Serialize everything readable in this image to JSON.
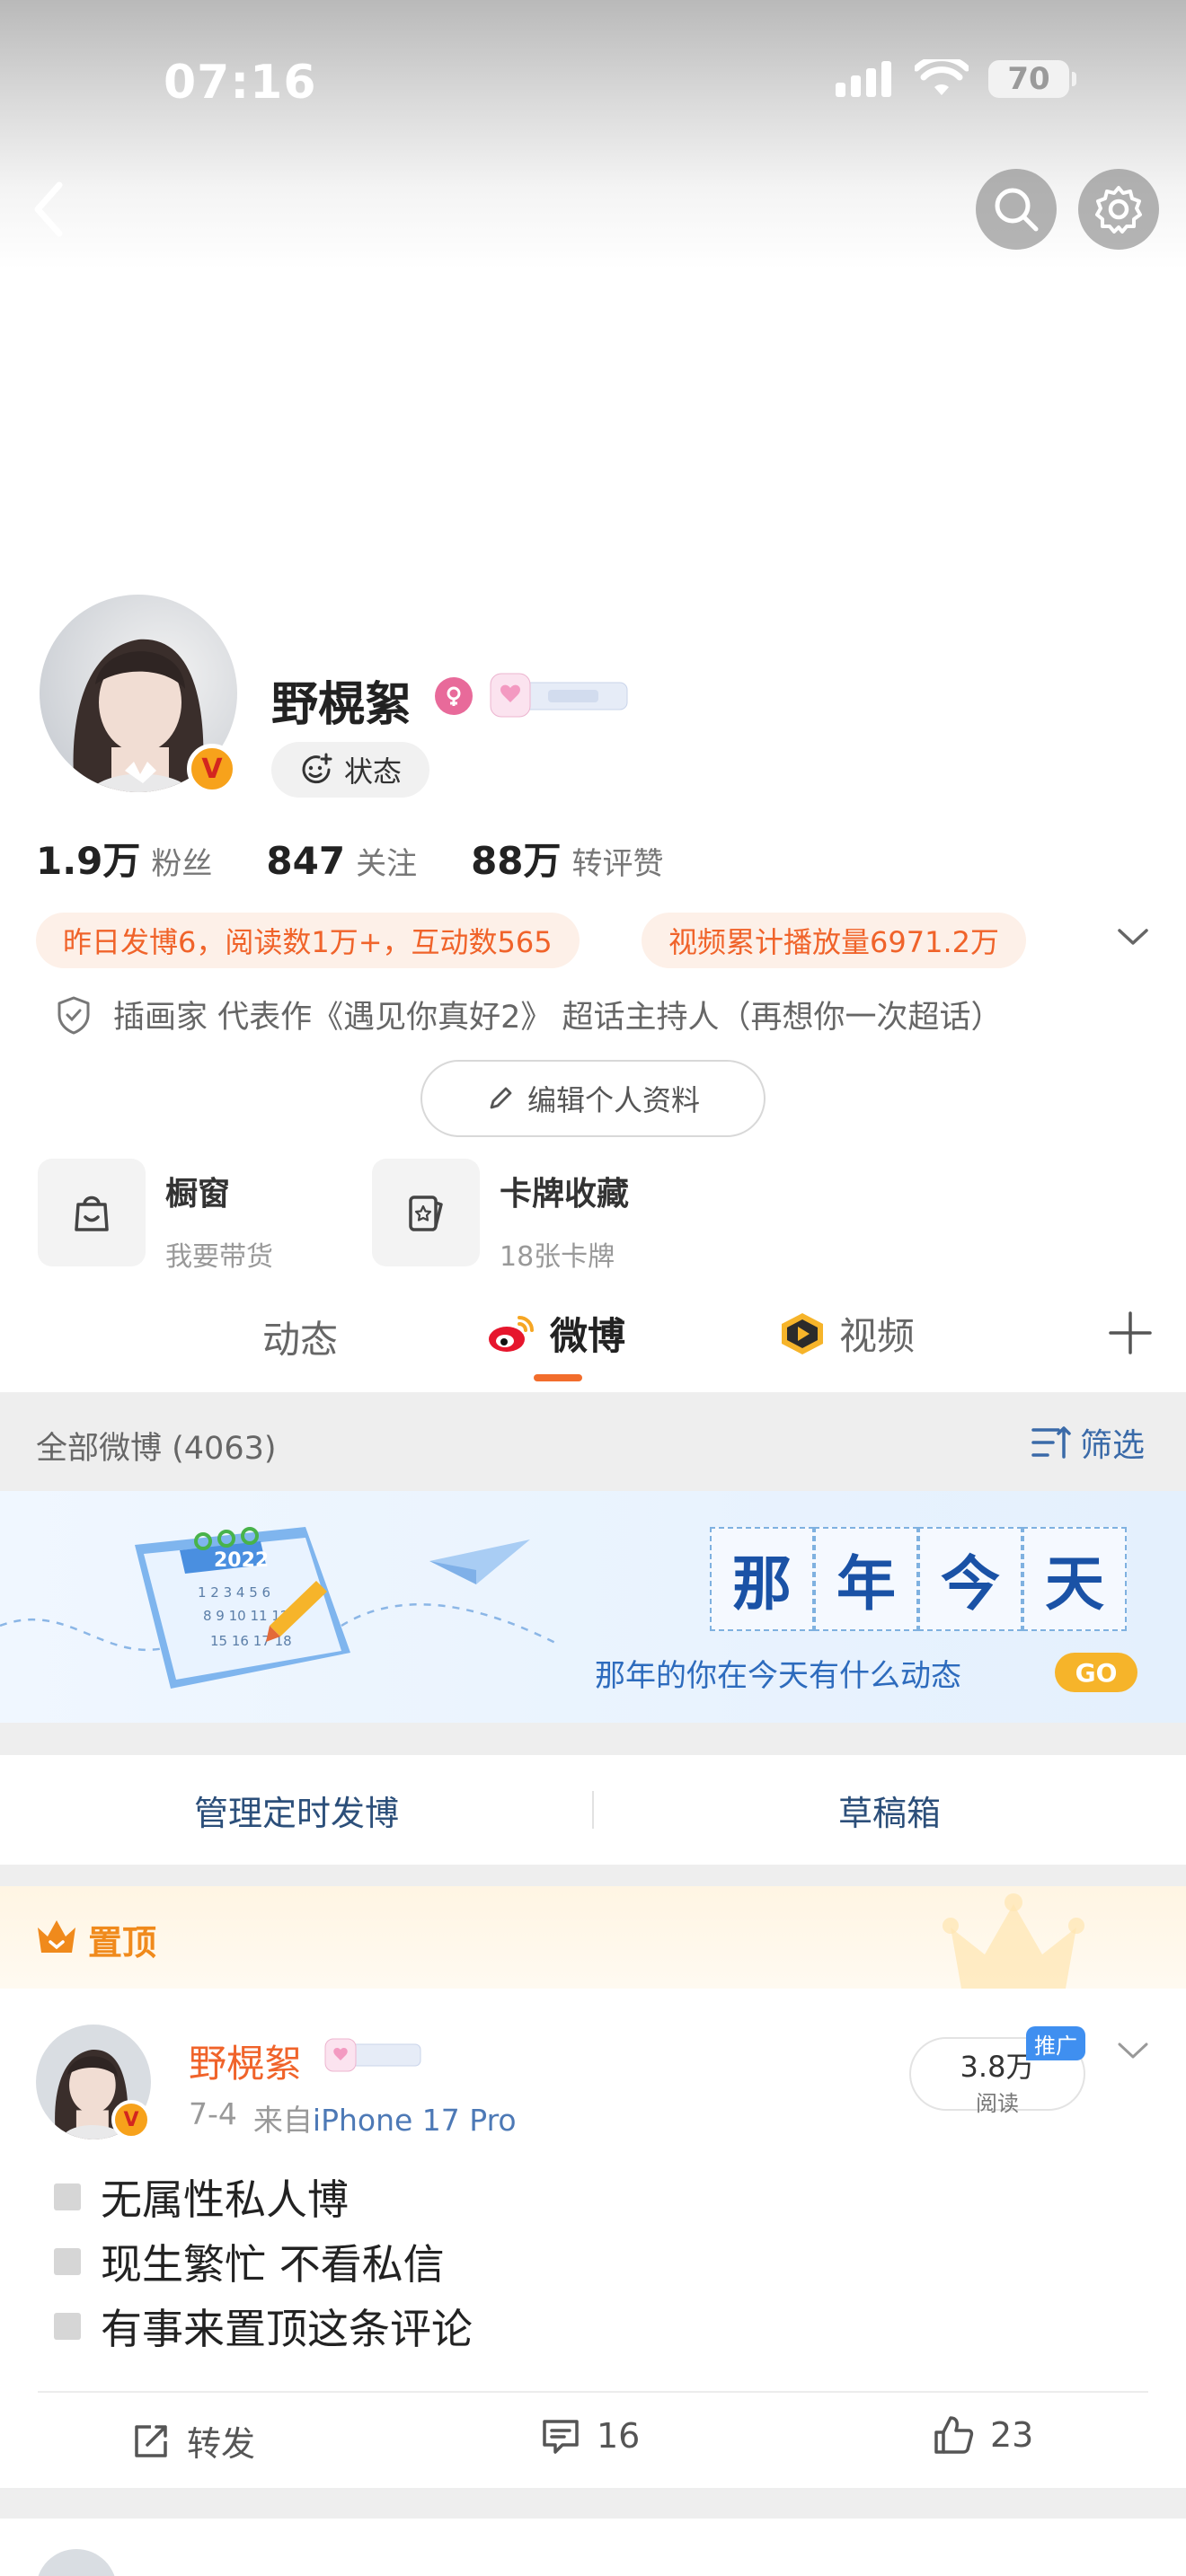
{
  "status_bar": {
    "time": "07:16",
    "battery": "70"
  },
  "profile": {
    "name": "野榥絮",
    "status_button": "状态",
    "stats": [
      {
        "value": "1.9万",
        "label": "粉丝"
      },
      {
        "value": "847",
        "label": "关注"
      },
      {
        "value": "88万",
        "label": "转评赞"
      }
    ],
    "tags": [
      "昨日发博6，阅读数1万+，互动数565",
      "视频累计播放量6971.2万"
    ],
    "bio": "插画家 代表作《遇见你真好2》 超话主持人（再想你一次超话）",
    "edit_button": "编辑个人资料"
  },
  "tools": [
    {
      "title": "橱窗",
      "subtitle": "我要带货",
      "icon": "bag-icon"
    },
    {
      "title": "卡牌收藏",
      "subtitle": "18张卡牌",
      "icon": "card-icon"
    }
  ],
  "tabs": [
    {
      "label": "动态"
    },
    {
      "label": "微博"
    },
    {
      "label": "视频"
    }
  ],
  "feed": {
    "count_label": "全部微博 (4063)",
    "filter_label": "筛选",
    "banner": {
      "chars": [
        "那",
        "年",
        "今",
        "天"
      ],
      "subtitle": "那年的你在今天有什么动态",
      "go_label": "GO",
      "calendar_year": "2022"
    },
    "schedule_label": "管理定时发博",
    "drafts_label": "草稿箱",
    "pinned_label": "置顶"
  },
  "post": {
    "author": "野榥絮",
    "date": "7-4",
    "source_prefix": "来自",
    "source": "iPhone 17 Pro",
    "reads_value": "3.8万",
    "reads_label": "阅读",
    "ad_tag": "推广",
    "lines": [
      "无属性私人博",
      "现生繁忙 不看私信",
      "有事来置顶这条评论"
    ],
    "repost_label": "转发",
    "comments": "16",
    "likes": "23"
  },
  "colors": {
    "accent": "#f26d2c",
    "tag_text": "#f0632a",
    "tag_bg": "#fdf0e8",
    "blue": "#1a52a6"
  }
}
